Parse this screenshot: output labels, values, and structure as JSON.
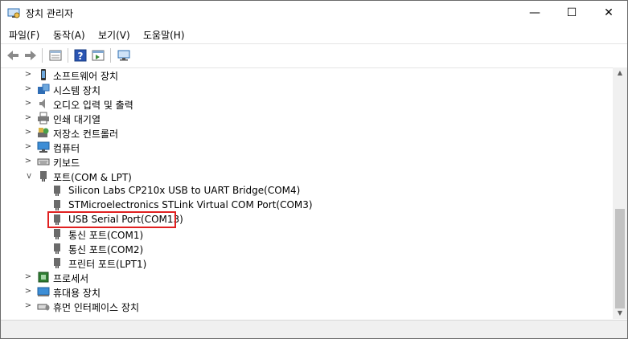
{
  "window": {
    "title": "장치 관리자",
    "minimize": "—",
    "maximize": "☐",
    "close": "✕"
  },
  "menu": [
    "파일(F)",
    "동작(A)",
    "보기(V)",
    "도움말(H)"
  ],
  "toolbar": {
    "icons": [
      "back-icon",
      "forward-icon",
      "properties-icon",
      "help-icon",
      "panel-icon",
      "monitor-icon"
    ]
  },
  "tree": {
    "categories_top": [
      {
        "label": "소프트웨어 장치",
        "icon": "phone-icon"
      },
      {
        "label": "시스템 장치",
        "icon": "system-icon"
      },
      {
        "label": "오디오 입력 및 출력",
        "icon": "speaker-icon"
      },
      {
        "label": "인쇄 대기열",
        "icon": "printer-icon"
      },
      {
        "label": "저장소 컨트롤러",
        "icon": "storage-icon"
      },
      {
        "label": "컴퓨터",
        "icon": "computer-icon"
      },
      {
        "label": "키보드",
        "icon": "keyboard-icon"
      }
    ],
    "ports": {
      "label": "포트(COM & LPT)",
      "children": [
        "Silicon Labs CP210x USB to UART Bridge(COM4)",
        "STMicroelectronics STLink Virtual COM Port(COM3)",
        "USB Serial Port(COM13)",
        "통신 포트(COM1)",
        "통신 포트(COM2)",
        "프린터 포트(LPT1)"
      ],
      "highlighted": "USB Serial Port(COM13)"
    },
    "categories_bottom": [
      {
        "label": "프로세서",
        "icon": "cpu-icon"
      },
      {
        "label": "휴대용 장치",
        "icon": "portable-icon"
      },
      {
        "label": "휴먼 인터페이스 장치",
        "icon": "hid-icon"
      }
    ]
  },
  "colors": {
    "highlight": "#e02020",
    "scroll_thumb": "#c2c2c2"
  }
}
